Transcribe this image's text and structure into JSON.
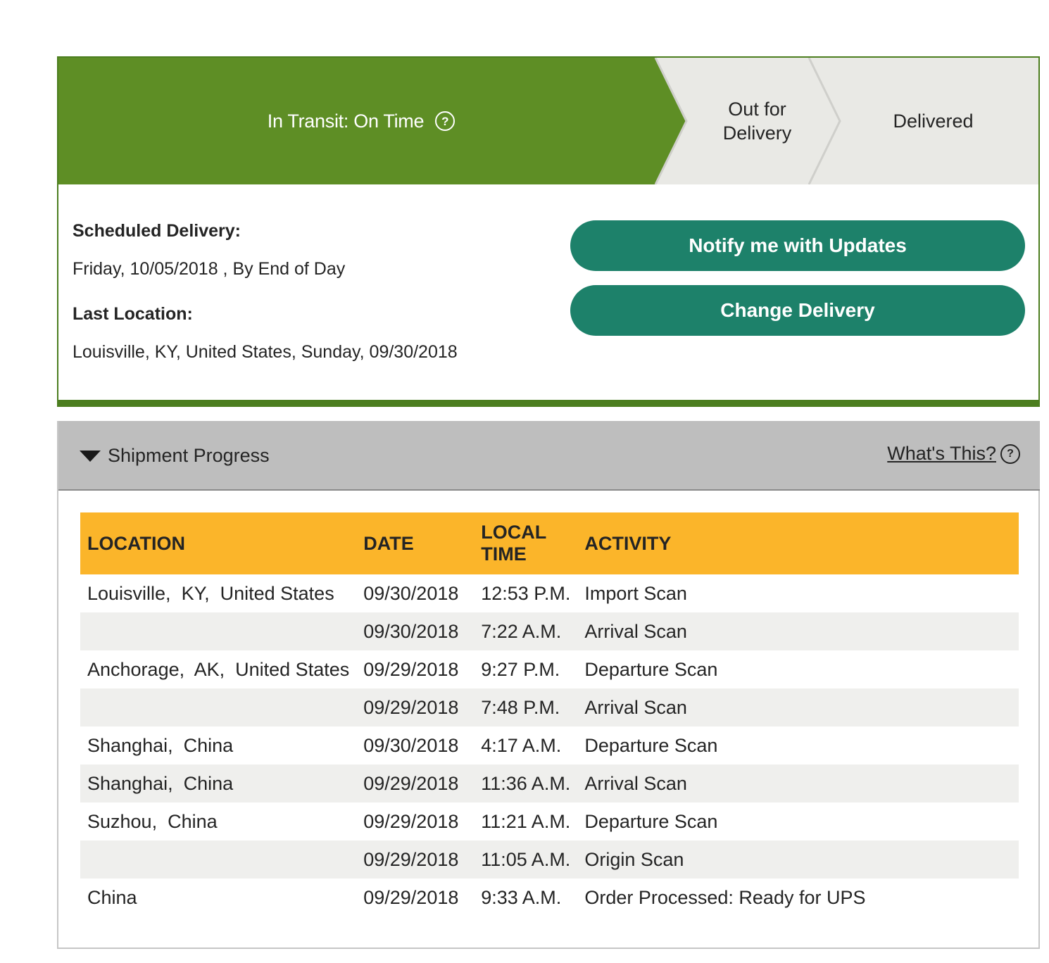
{
  "status": {
    "steps": {
      "in_transit": "In Transit: On Time",
      "out_for_delivery_line1": "Out for",
      "out_for_delivery_line2": "Delivery",
      "delivered": "Delivered"
    },
    "help_glyph": "?",
    "colors": {
      "active": "#5e8e25",
      "inactive": "#e9e9e5",
      "border": "#4c7e1f"
    }
  },
  "details": {
    "scheduled_label": "Scheduled Delivery:",
    "scheduled_value": "Friday, 10/05/2018 , By End of Day",
    "last_location_label": "Last Location:",
    "last_location_value": "Louisville, KY, United States, Sunday, 09/30/2018"
  },
  "buttons": {
    "notify": "Notify me with Updates",
    "change": "Change Delivery",
    "color": "#1d816a"
  },
  "shipment_progress": {
    "title": "Shipment Progress",
    "whats_this": "What's This?",
    "header_color": "#fbb52a",
    "columns": {
      "location": "LOCATION",
      "date": "DATE",
      "local_time_line1": "LOCAL",
      "local_time_line2": "TIME",
      "activity": "ACTIVITY"
    },
    "rows": [
      {
        "location": "Louisville,  KY,  United States",
        "date": "09/30/2018",
        "time": "12:53 P.M.",
        "activity": "Import Scan"
      },
      {
        "location": "",
        "date": "09/30/2018",
        "time": "7:22 A.M.",
        "activity": "Arrival Scan"
      },
      {
        "location": "Anchorage,  AK,  United States",
        "date": "09/29/2018",
        "time": "9:27 P.M.",
        "activity": "Departure Scan"
      },
      {
        "location": "",
        "date": "09/29/2018",
        "time": "7:48 P.M.",
        "activity": "Arrival Scan"
      },
      {
        "location": "Shanghai,  China",
        "date": "09/30/2018",
        "time": "4:17 A.M.",
        "activity": "Departure Scan"
      },
      {
        "location": "Shanghai,  China",
        "date": "09/29/2018",
        "time": "11:36 A.M.",
        "activity": "Arrival Scan"
      },
      {
        "location": "Suzhou,  China",
        "date": "09/29/2018",
        "time": "11:21 A.M.",
        "activity": "Departure Scan"
      },
      {
        "location": "",
        "date": "09/29/2018",
        "time": "11:05 A.M.",
        "activity": "Origin Scan"
      },
      {
        "location": "China",
        "date": "09/29/2018",
        "time": "9:33 A.M.",
        "activity": "Order Processed: Ready for UPS"
      }
    ]
  }
}
